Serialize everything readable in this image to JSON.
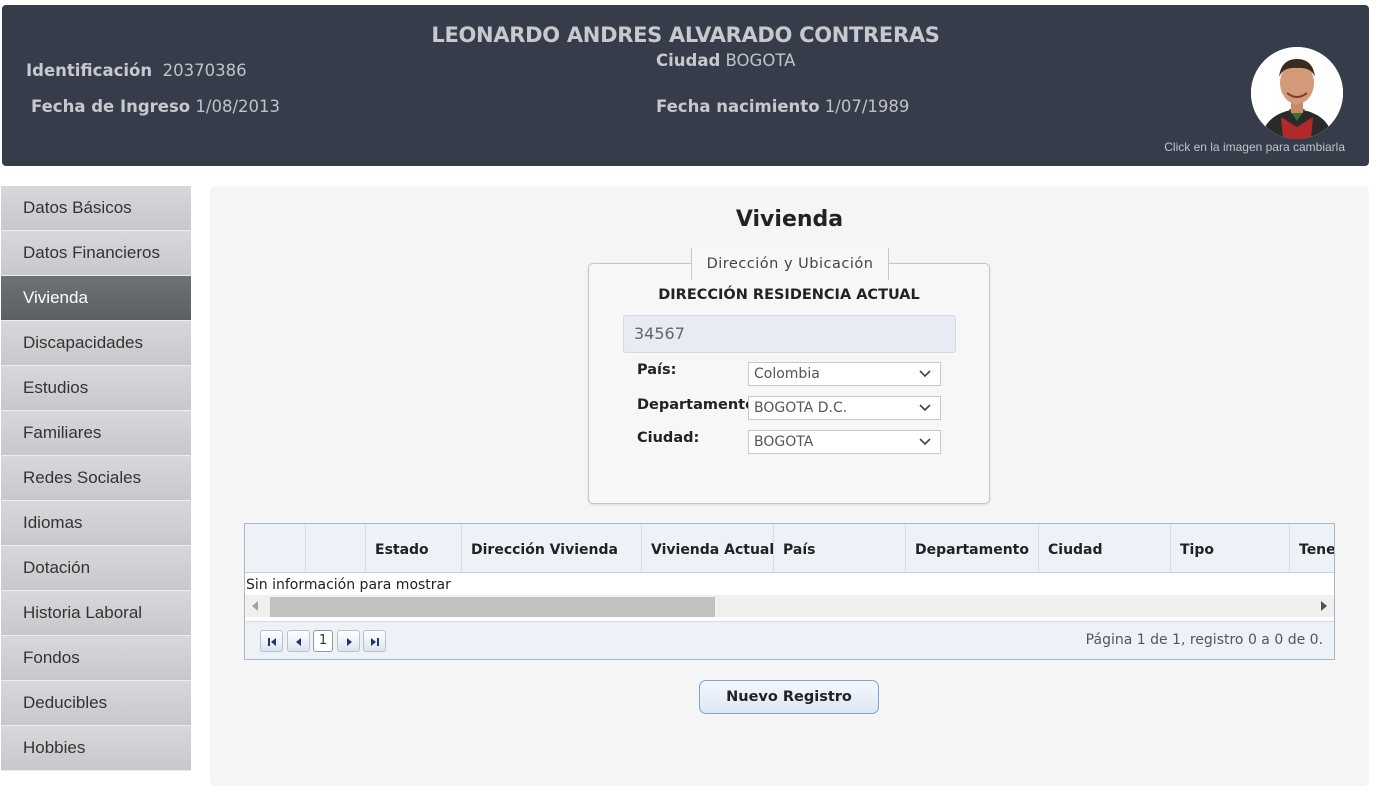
{
  "header": {
    "name": "LEONARDO ANDRES ALVARADO CONTRERAS",
    "identificacion_label": "Identificación",
    "identificacion_value": "20370386",
    "fecha_ingreso_label": "Fecha de Ingreso",
    "fecha_ingreso_value": "1/08/2013",
    "ciudad_label": "Ciudad",
    "ciudad_value": "BOGOTA",
    "fecha_nacimiento_label": "Fecha nacimiento",
    "fecha_nacimiento_value": "1/07/1989",
    "avatar_caption": "Click en la imagen para cambiarla"
  },
  "sidebar": {
    "items": [
      {
        "label": "Datos Básicos"
      },
      {
        "label": "Datos Financieros"
      },
      {
        "label": "Vivienda"
      },
      {
        "label": "Discapacidades"
      },
      {
        "label": "Estudios"
      },
      {
        "label": "Familiares"
      },
      {
        "label": "Redes Sociales"
      },
      {
        "label": "Idiomas"
      },
      {
        "label": "Dotación"
      },
      {
        "label": "Historia Laboral"
      },
      {
        "label": "Fondos"
      },
      {
        "label": "Deducibles"
      },
      {
        "label": "Hobbies"
      }
    ],
    "active": "Vivienda"
  },
  "main": {
    "title": "Vivienda",
    "fieldset": {
      "legend": "Dirección y Ubicación",
      "heading": "DIRECCIÓN RESIDENCIA ACTUAL",
      "address_value": "34567",
      "pais_label": "País:",
      "pais_value": "Colombia",
      "departamento_label": "Departamento:",
      "departamento_value": "BOGOTA D.C.",
      "ciudad_label": "Ciudad:",
      "ciudad_value": "BOGOTA"
    },
    "grid": {
      "columns": [
        "",
        "",
        "Estado",
        "Dirección Vivienda",
        "Vivienda Actual",
        "País",
        "Departamento",
        "Ciudad",
        "Tipo",
        "Tener"
      ],
      "empty_message": "Sin información para mostrar",
      "page_number": "1",
      "page_info": "Página 1 de 1, registro 0 a 0 de 0."
    },
    "new_button": "Nuevo Registro"
  }
}
